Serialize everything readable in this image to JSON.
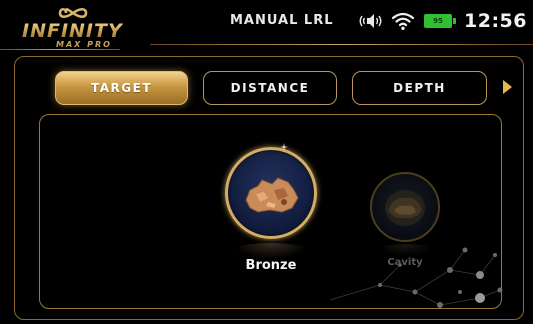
{
  "header": {
    "brand": "INFINITY",
    "brand_sub": "MAX PRO",
    "mode_title": "MANUAL LRL",
    "battery_level": "95",
    "clock": "12:56"
  },
  "tabs": [
    {
      "label": "TARGET",
      "active": true
    },
    {
      "label": "DISTANCE",
      "active": false
    },
    {
      "label": "DEPTH",
      "active": false
    }
  ],
  "targets": [
    {
      "label": "Bronze",
      "selected": true
    },
    {
      "label": "Cavity",
      "selected": false
    }
  ],
  "icons": {
    "logo_symbol": "infinity-icon",
    "speaker": "speaker-icon",
    "wifi": "wifi-icon",
    "battery": "battery-icon",
    "next": "right-arrow-icon"
  },
  "colors": {
    "accent_gold": "#c9a45c",
    "active_tab": "#c79642",
    "battery": "#2fc12f",
    "circle_bg": "#101a3a"
  }
}
